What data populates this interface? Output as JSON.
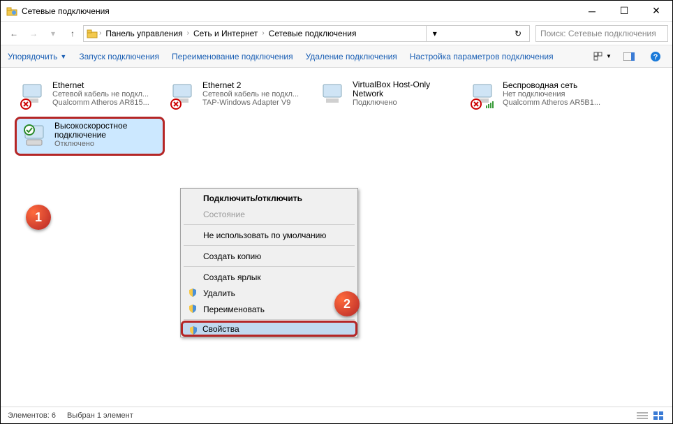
{
  "window": {
    "title": "Сетевые подключения"
  },
  "breadcrumb": {
    "items": [
      "Панель управления",
      "Сеть и Интернет",
      "Сетевые подключения"
    ]
  },
  "search": {
    "placeholder": "Поиск: Сетевые подключения"
  },
  "toolbar": {
    "organize": "Упорядочить",
    "start": "Запуск подключения",
    "rename": "Переименование подключения",
    "delete": "Удаление подключения",
    "settings": "Настройка параметров подключения"
  },
  "connections": [
    {
      "name": "Ethernet",
      "status": "Сетевой кабель не подкл...",
      "device": "Qualcomm Atheros AR815...",
      "overlay": "x"
    },
    {
      "name": "Ethernet 2",
      "status": "Сетевой кабель не подкл...",
      "device": "TAP-Windows Adapter V9",
      "overlay": "x"
    },
    {
      "name": "VirtualBox Host-Only Network",
      "status": "Подключено",
      "device": "",
      "overlay": ""
    },
    {
      "name": "Беспроводная сеть",
      "status": "Нет подключения",
      "device": "Qualcomm Atheros AR5B1...",
      "overlay": "x-bars"
    },
    {
      "name": "Высокоскоростное подключение",
      "status": "Отключено",
      "device": "",
      "overlay": "check",
      "selected": true
    }
  ],
  "context_menu": {
    "items": [
      {
        "label": "Подключить/отключить",
        "bold": true
      },
      {
        "label": "Состояние",
        "disabled": true
      },
      {
        "sep": true
      },
      {
        "label": "Не использовать по умолчанию"
      },
      {
        "sep": true
      },
      {
        "label": "Создать копию"
      },
      {
        "sep": true
      },
      {
        "label": "Создать ярлык"
      },
      {
        "label": "Удалить",
        "shield": true
      },
      {
        "label": "Переименовать",
        "shield": true
      },
      {
        "sep": true
      },
      {
        "label": "Свойства",
        "shield": true,
        "highlight": true
      }
    ]
  },
  "status": {
    "elements": "Элементов: 6",
    "selected": "Выбран 1 элемент"
  },
  "callouts": {
    "one": "1",
    "two": "2"
  }
}
